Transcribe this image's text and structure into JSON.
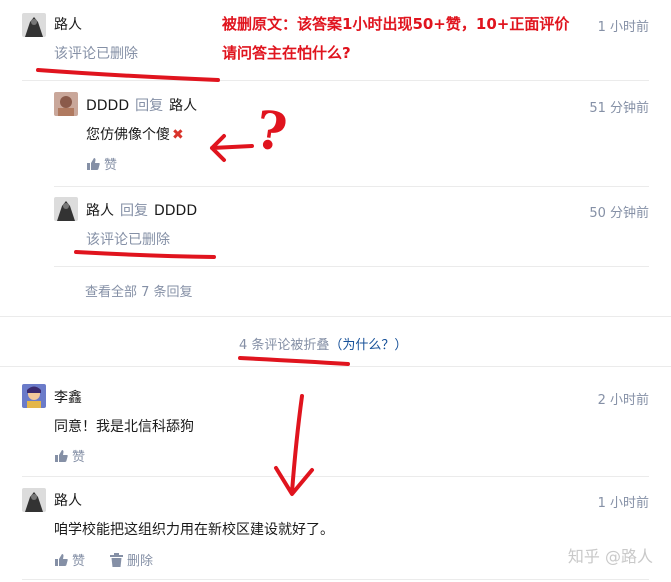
{
  "annotation": {
    "line1": "被删原文：该答案1小时出现50+赞，10+正面评价",
    "line2": "请问答主在怕什么?",
    "question_mark": "?"
  },
  "comments": {
    "c1": {
      "author": "路人",
      "time": "1 小时前",
      "deleted": "该评论已删除"
    },
    "r1": {
      "author": "DDDD",
      "reply_word": "回复",
      "target": "路人",
      "time": "51 分钟前",
      "content": "您仿佛像个傻",
      "like": "赞"
    },
    "r2": {
      "author": "路人",
      "reply_word": "回复",
      "target": "DDDD",
      "time": "50 分钟前",
      "deleted": "该评论已删除"
    },
    "view_all": "查看全部 7 条回复",
    "fold": {
      "count": "4 条评论被折叠",
      "why": "（为什么？）"
    },
    "c2": {
      "author": "李鑫",
      "time": "2 小时前",
      "content": "同意！我是北信科舔狗",
      "like": "赞"
    },
    "c3": {
      "author": "路人",
      "time": "1 小时前",
      "content": "咱学校能把这组织力用在新校区建设就好了。",
      "like": "赞",
      "delete": "删除"
    }
  },
  "watermark": "知乎 @路人",
  "colors": {
    "annotation_red": "#e0141e",
    "muted": "#8590a6",
    "link_blue": "#175199"
  }
}
